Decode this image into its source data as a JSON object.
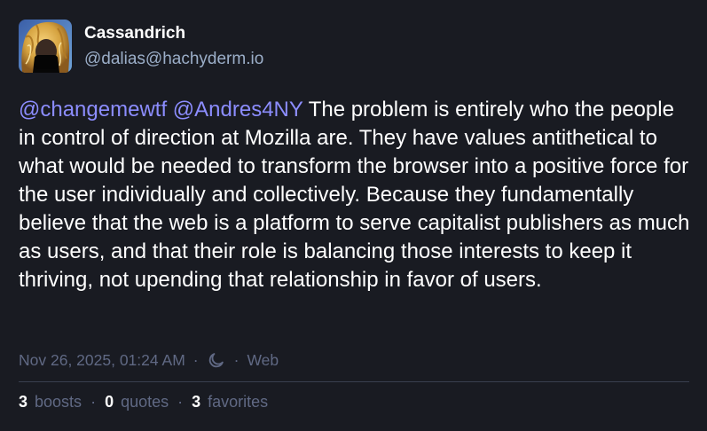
{
  "author": {
    "display_name": "Cassandrich",
    "handle": "@dalias@hachyderm.io"
  },
  "post": {
    "mention_1": "@changemewtf",
    "mention_2": "@Andres4NY",
    "text": " The problem is entirely who the people in control of direction at Mozilla are. They have values antithetical to what would be needed to transform the browser into a positive force for the user individually and collectively. Because they fundamentally believe that the web is a platform to serve capitalist publishers as much as users, and that their role is balancing those interests to keep it thriving, not upending that relationship in favor of users."
  },
  "meta": {
    "timestamp": "Nov 26, 2025, 01:24 AM",
    "separator": "·",
    "visibility_icon": "moon-icon",
    "application": "Web"
  },
  "stats": {
    "boosts_count": "3",
    "boosts_label": "boosts",
    "quotes_count": "0",
    "quotes_label": "quotes",
    "favorites_count": "3",
    "favorites_label": "favorites"
  },
  "colors": {
    "background": "#191b22",
    "text": "#ffffff",
    "muted": "#606984",
    "handle": "#9baec8",
    "mention": "#8c8dff",
    "divider": "#393f4f"
  }
}
